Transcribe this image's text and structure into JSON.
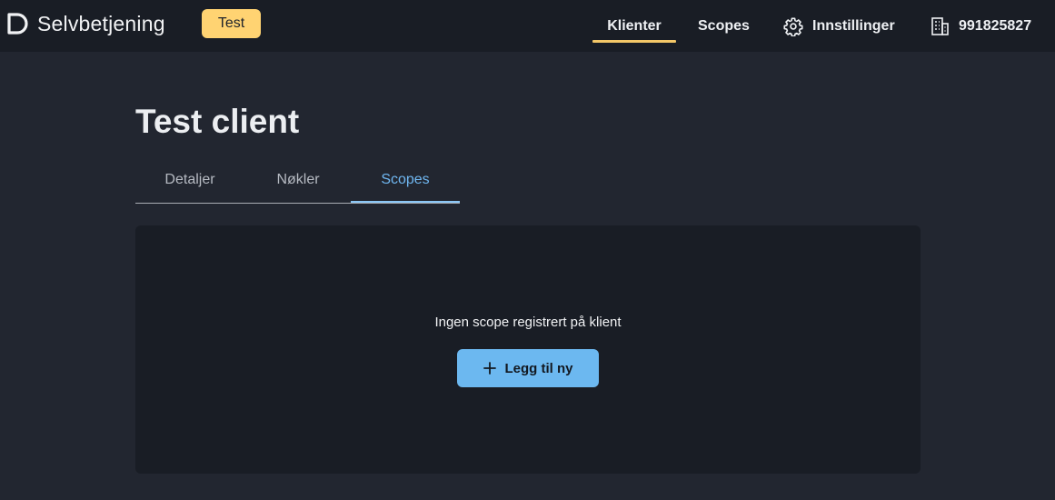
{
  "header": {
    "brand_name": "Selvbetjening",
    "brand_icon": "d-logo-icon",
    "environment_badge": "Test",
    "nav": {
      "clients": "Klienter",
      "scopes": "Scopes",
      "settings": "Innstillinger",
      "settings_icon": "gear-icon",
      "organization": "991825827",
      "organization_icon": "building-icon"
    },
    "active_nav": "clients"
  },
  "main": {
    "title": "Test client",
    "tabs": [
      {
        "label": "Detaljer"
      },
      {
        "label": "Nøkler"
      },
      {
        "label": "Scopes"
      }
    ],
    "active_tab": "Scopes",
    "empty_state": {
      "message": "Ingen scope registrert på klient",
      "button_label": "Legg til ny",
      "button_icon": "plus-icon"
    }
  },
  "colors": {
    "header_bg": "#191d25",
    "page_bg": "#222630",
    "badge": "#ffd372",
    "nav_underline": "#f3c768",
    "active_tab": "#6fb6f0",
    "primary_button": "#6cb8f0"
  }
}
